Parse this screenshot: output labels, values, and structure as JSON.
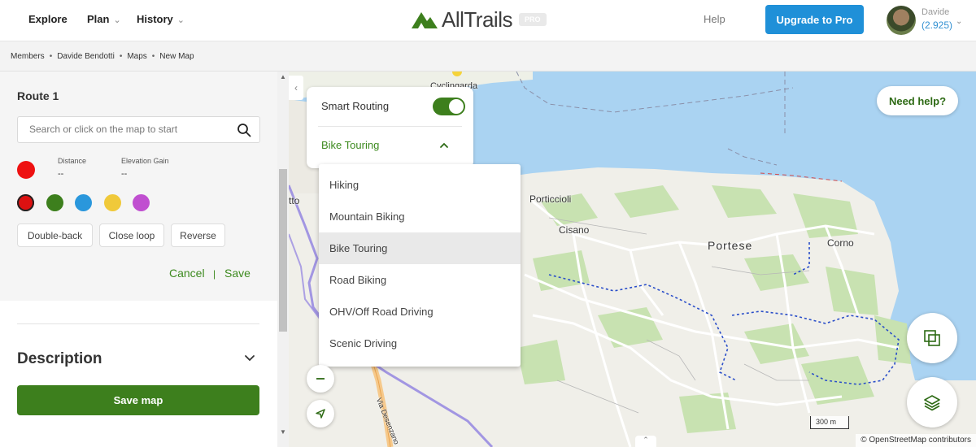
{
  "header": {
    "nav": [
      {
        "label": "Explore",
        "has_dropdown": false
      },
      {
        "label": "Plan",
        "has_dropdown": true
      },
      {
        "label": "History",
        "has_dropdown": true
      }
    ],
    "logo_text": "AllTrails",
    "logo_badge": "PRO",
    "help": "Help",
    "upgrade_label": "Upgrade to Pro",
    "user": {
      "name": "Davide",
      "points": "(2.925)"
    },
    "brand_color": "#3d7f1d",
    "upgrade_color": "#1f90d8"
  },
  "breadcrumb": [
    "Members",
    "Davide Bendotti",
    "Maps",
    "New Map"
  ],
  "route": {
    "title": "Route 1",
    "search_placeholder": "Search or click on the map to start",
    "distance_label": "Distance",
    "distance_value": "--",
    "elevation_label": "Elevation Gain",
    "elevation_value": "--",
    "active_color": "#ee1111",
    "swatches": [
      "#dd1111",
      "#3d7f1d",
      "#2a97dc",
      "#f0c93a",
      "#c04fd0"
    ],
    "selected_swatch": 0,
    "buttons": [
      "Double-back",
      "Close loop",
      "Reverse"
    ],
    "cancel": "Cancel",
    "save": "Save"
  },
  "description": {
    "title": "Description"
  },
  "save_map_label": "Save map",
  "map": {
    "smart_routing_label": "Smart Routing",
    "smart_routing_on": true,
    "activity_selected": "Bike Touring",
    "activity_options": [
      "Hiking",
      "Mountain Biking",
      "Bike Touring",
      "Road Biking",
      "OHV/Off Road Driving",
      "Scenic Driving"
    ],
    "need_help": "Need help?",
    "place_labels": [
      "Porticcioli",
      "Cisano",
      "Portese",
      "Corno",
      "Cyclingarda",
      "Via Desenzano",
      "tto"
    ],
    "scale": "300 m",
    "attribution": "© OpenStreetMap contributors"
  }
}
